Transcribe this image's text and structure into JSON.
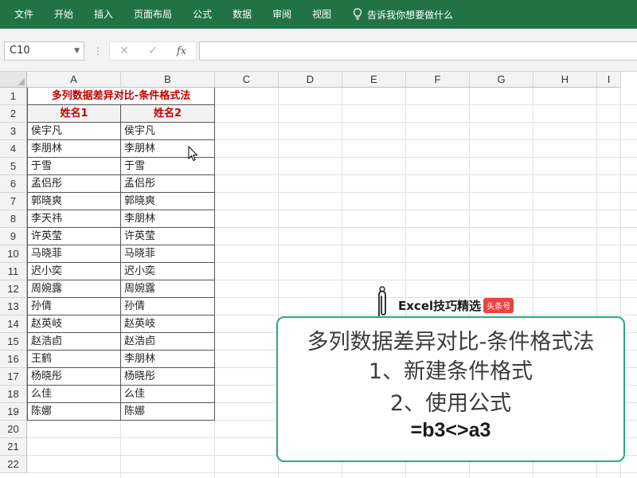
{
  "ribbon": {
    "tabs": [
      "文件",
      "开始",
      "插入",
      "页面布局",
      "公式",
      "数据",
      "审阅",
      "视图"
    ],
    "tell_me": "告诉我你想要做什么",
    "color": "#217346"
  },
  "formula_bar": {
    "name_box": "C10",
    "cancel_icon": "✕",
    "enter_icon": "✓",
    "fx_label": "fx",
    "formula": ""
  },
  "sheet": {
    "columns": [
      "A",
      "B",
      "C",
      "D",
      "E",
      "F",
      "G",
      "H",
      "I"
    ],
    "rows": [
      "1",
      "2",
      "3",
      "4",
      "5",
      "6",
      "7",
      "8",
      "9",
      "10",
      "11",
      "12",
      "13",
      "14",
      "15",
      "16",
      "17",
      "18",
      "19",
      "20",
      "21",
      "22"
    ],
    "title": "多列数据差异对比-条件格式法",
    "header": [
      "姓名1",
      "姓名2"
    ],
    "data": [
      [
        "侯宇凡",
        "侯宇凡"
      ],
      [
        "李朋林",
        "李朋林"
      ],
      [
        "于雪",
        "于雪"
      ],
      [
        "孟侣彤",
        "孟侣彤"
      ],
      [
        "郭晓爽",
        "郭晓爽"
      ],
      [
        "李天祎",
        "李朋林"
      ],
      [
        "许英莹",
        "许英莹"
      ],
      [
        "马晓菲",
        "马晓菲"
      ],
      [
        "迟小奕",
        "迟小奕"
      ],
      [
        "周婉露",
        "周婉露"
      ],
      [
        "孙倩",
        "孙倩"
      ],
      [
        "赵英岐",
        "赵英岐"
      ],
      [
        "赵浩卣",
        "赵浩卣"
      ],
      [
        "王鹤",
        "李朋林"
      ],
      [
        "杨晓彤",
        "杨晓彤"
      ],
      [
        "么佳",
        "么佳"
      ],
      [
        "陈娜",
        "陈娜"
      ]
    ],
    "accent_color": "#c00000"
  },
  "overlay": {
    "brand": "Excel技巧精选",
    "badge": "头条号",
    "title": "多列数据差异对比-条件格式法",
    "step1": "1、新建条件格式",
    "step2": "2、使用公式",
    "formula": "=b3<>a3",
    "border_color": "#2aa88a"
  }
}
